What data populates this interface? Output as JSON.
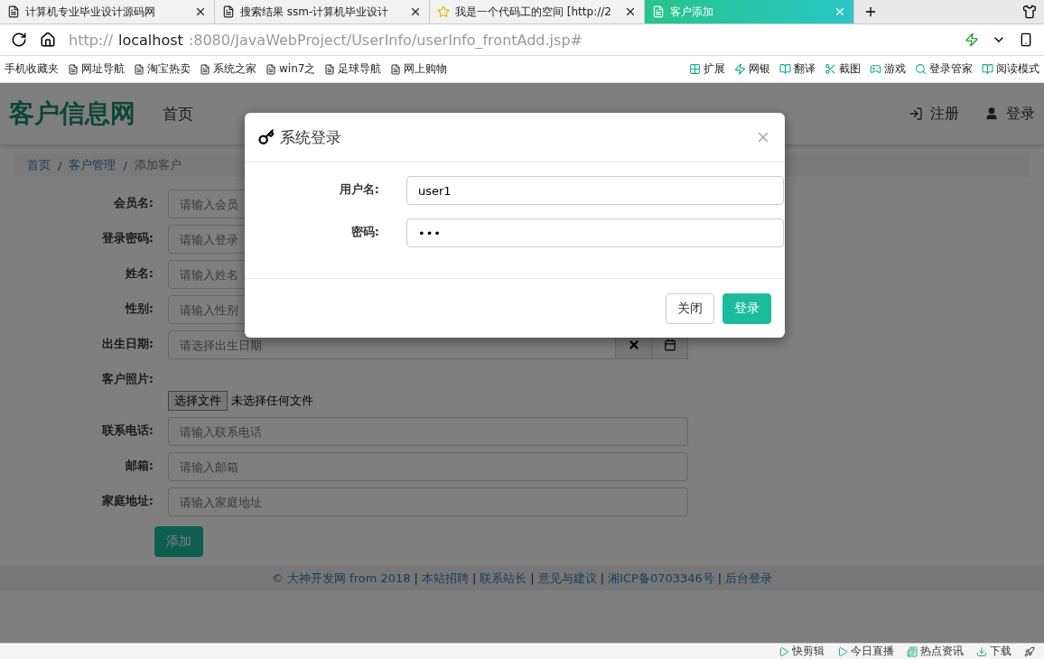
{
  "browser": {
    "tabs": [
      {
        "title": "计算机专业毕业设计源码网",
        "selected": false
      },
      {
        "title": "搜索结果 ssm-计算机毕业设计",
        "selected": false
      },
      {
        "title": "我是一个代码工的空间 [http://2",
        "selected": false
      },
      {
        "title": "客户添加",
        "selected": true
      }
    ],
    "address": {
      "scheme": "http://",
      "host": "localhost",
      "rest": ":8080/JavaWebProject/UserInfo/userInfo_frontAdd.jsp#"
    },
    "bookmarks": [
      "手机收藏夹",
      "网址导航",
      "淘宝热卖",
      "系统之家",
      "win7之",
      "足球导航",
      "网上购物"
    ],
    "tools": [
      "扩展",
      "网银",
      "翻译",
      "截图",
      "游戏",
      "登录管家",
      "阅读模式"
    ]
  },
  "site": {
    "logo": "客户信息网",
    "nav": [
      "首页"
    ],
    "register": "注册",
    "login": "登录"
  },
  "breadcrumb": [
    {
      "kind": "link",
      "text": "首页"
    },
    {
      "kind": "separator",
      "text": "/"
    },
    {
      "kind": "link",
      "text": "客户管理"
    },
    {
      "kind": "separator",
      "text": "/"
    },
    {
      "kind": "current",
      "text": "添加客户"
    }
  ],
  "form": {
    "fields": [
      {
        "kind": "text",
        "label": "会员名:",
        "placeholder": "请输入会员"
      },
      {
        "kind": "text",
        "label": "登录密码:",
        "placeholder": "请输入登录"
      },
      {
        "kind": "text",
        "label": "姓名:",
        "placeholder": "请输入姓名"
      },
      {
        "kind": "text",
        "label": "性别:",
        "placeholder": "请输入性别"
      },
      {
        "kind": "date",
        "label": "出生日期:",
        "placeholder": "请选择出生日期"
      },
      {
        "kind": "file",
        "label": "客户照片:",
        "button": "选择文件",
        "status": "未选择任何文件"
      },
      {
        "kind": "text",
        "label": "联系电话:",
        "placeholder": "请输入联系电话"
      },
      {
        "kind": "text",
        "label": "邮箱:",
        "placeholder": "请输入邮箱"
      },
      {
        "kind": "text",
        "label": "家庭地址:",
        "placeholder": "请输入家庭地址"
      }
    ],
    "submit": "添加"
  },
  "footer": [
    {
      "kind": "link",
      "text": "© 大神开发网 from 2018"
    },
    {
      "kind": "separator",
      "text": "|"
    },
    {
      "kind": "link",
      "text": "本站招聘"
    },
    {
      "kind": "separator",
      "text": "|"
    },
    {
      "kind": "link",
      "text": "联系站长"
    },
    {
      "kind": "separator",
      "text": "|"
    },
    {
      "kind": "link",
      "text": "意见与建议"
    },
    {
      "kind": "separator",
      "text": "|"
    },
    {
      "kind": "link",
      "text": "湘ICP备0703346号"
    },
    {
      "kind": "separator",
      "text": "|"
    },
    {
      "kind": "link",
      "text": "后台登录"
    }
  ],
  "dialog": {
    "title": "系统登录",
    "fields": [
      {
        "kind": "username",
        "label": "用户名:",
        "value": "user1"
      },
      {
        "kind": "password",
        "label": "密码:",
        "value": "•••"
      }
    ],
    "buttons": [
      {
        "label": "关闭",
        "primary": false
      },
      {
        "label": "登录",
        "primary": true
      }
    ]
  },
  "status_bar": [
    "快剪辑",
    "今日直播",
    "热点资讯",
    "下载"
  ]
}
